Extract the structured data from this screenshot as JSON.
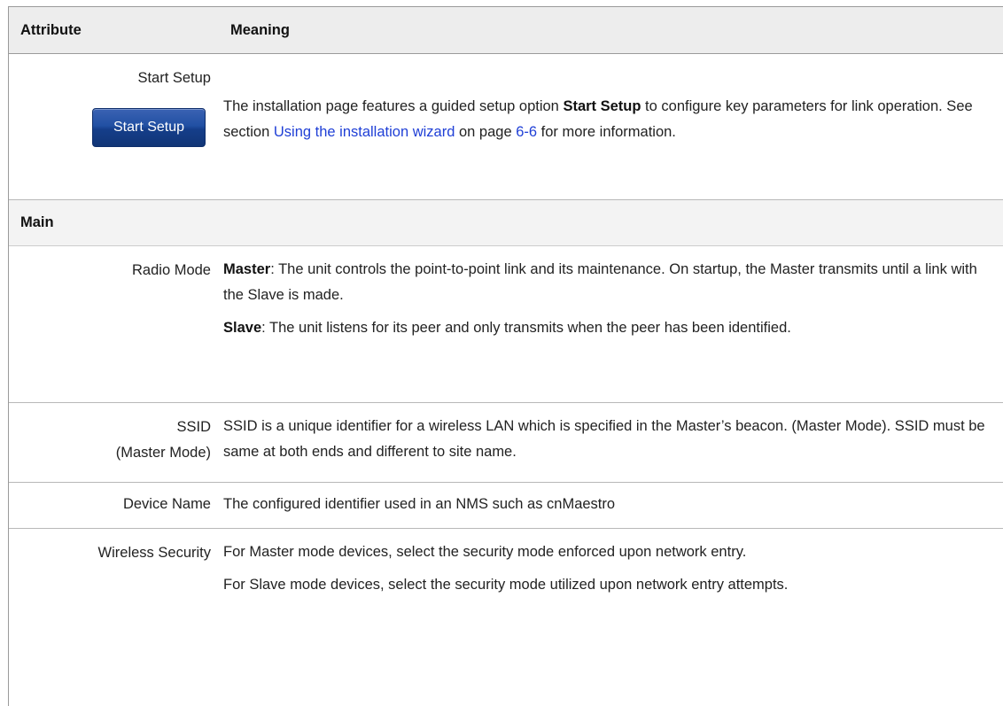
{
  "header": {
    "attribute": "Attribute",
    "meaning": "Meaning"
  },
  "start_setup": {
    "label": "Start Setup",
    "button_label": "Start Setup",
    "text_1": "The installation page features a guided setup option ",
    "text_bold": "Start Setup",
    "text_2": " to configure key parameters for link operation.  See section ",
    "link": "Using the installation wizard",
    "text_3": " on page ",
    "page_link": "6-6",
    "text_4": " for more information."
  },
  "section_main": "Main",
  "radio_mode": {
    "label": "Radio Mode",
    "master_bold": "Master",
    "master_text": ": The unit controls the point-to-point link and its maintenance. On startup, the Master transmits until a link with the Slave is made.",
    "slave_bold": "Slave",
    "slave_text": ": The unit listens for its peer and only transmits when the peer has been identified."
  },
  "ssid": {
    "label_1": "SSID",
    "label_2": "(Master Mode)",
    "text": "SSID is a unique identifier for a wireless LAN which is specified in the Master’s beacon. (Master Mode).  SSID must be same at both ends and different to site name."
  },
  "device_name": {
    "label": "Device Name",
    "text": "The configured identifier used in an NMS such as cnMaestro"
  },
  "wireless_security": {
    "label": "Wireless Security",
    "text_1": "For Master mode devices, select the security mode enforced upon network entry.",
    "text_2": "For Slave mode devices, select the security mode utilized upon network entry attempts."
  }
}
